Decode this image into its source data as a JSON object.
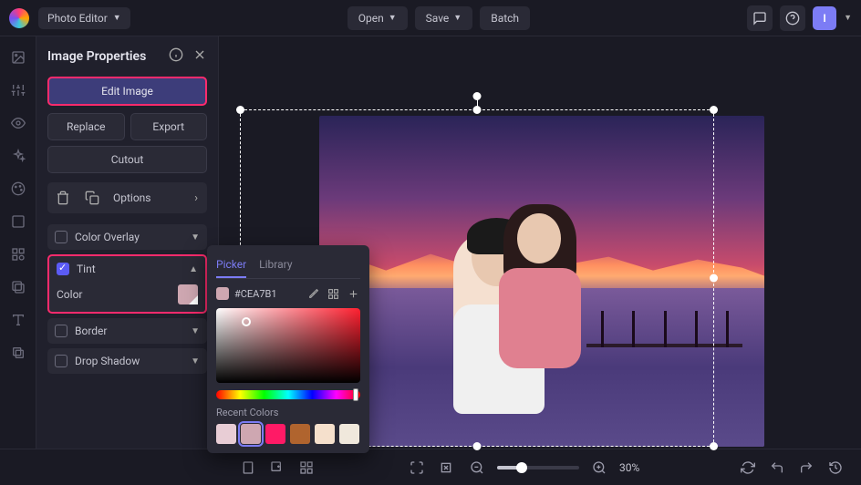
{
  "header": {
    "app_title": "Photo Editor",
    "open_label": "Open",
    "save_label": "Save",
    "batch_label": "Batch",
    "avatar_letter": "I"
  },
  "panel": {
    "title": "Image Properties",
    "edit_image_label": "Edit Image",
    "replace_label": "Replace",
    "export_label": "Export",
    "cutout_label": "Cutout",
    "options_label": "Options",
    "accordion": {
      "color_overlay": "Color Overlay",
      "tint": "Tint",
      "tint_color_label": "Color",
      "border": "Border",
      "drop_shadow": "Drop Shadow"
    }
  },
  "picker": {
    "tab_picker": "Picker",
    "tab_library": "Library",
    "hex_value": "#CEA7B1",
    "recent_label": "Recent Colors",
    "recent_colors": [
      "#E8CDD5",
      "#CEA7B1",
      "#FF1A66",
      "#B0642E",
      "#F5E0CC",
      "#F0E8DC"
    ]
  },
  "footer": {
    "zoom_pct": "30%"
  },
  "colors": {
    "tint": "#CEA7B1",
    "highlight": "#ff2b6d",
    "accent": "#7c7cf5"
  }
}
